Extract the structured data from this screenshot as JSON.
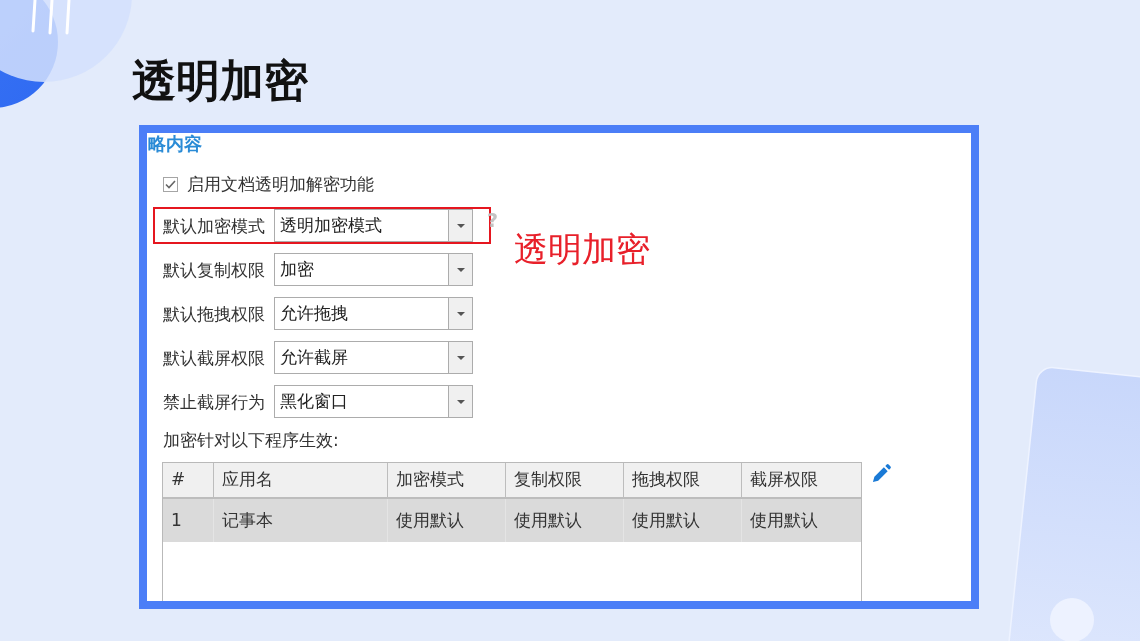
{
  "page": {
    "title": "透明加密"
  },
  "panel": {
    "section_title": "略内容",
    "enable_option": {
      "label": "启用文档透明加解密功能",
      "checked": true
    },
    "fields": [
      {
        "label": "默认加密模式",
        "value": "透明加密模式",
        "highlighted": true,
        "help": "?"
      },
      {
        "label": "默认复制权限",
        "value": "加密",
        "highlighted": false
      },
      {
        "label": "默认拖拽权限",
        "value": "允许拖拽",
        "highlighted": false
      },
      {
        "label": "默认截屏权限",
        "value": "允许截屏",
        "highlighted": false
      },
      {
        "label": "禁止截屏行为",
        "value": "黑化窗口",
        "highlighted": false
      }
    ],
    "annotation": "透明加密",
    "table_caption": "加密针对以下程序生效:",
    "table": {
      "columns": [
        "#",
        "应用名",
        "加密模式",
        "复制权限",
        "拖拽权限",
        "截屏权限"
      ],
      "rows": [
        {
          "cells": [
            "1",
            "记事本",
            "使用默认",
            "使用默认",
            "使用默认",
            "使用默认"
          ],
          "selected": true
        }
      ]
    }
  }
}
